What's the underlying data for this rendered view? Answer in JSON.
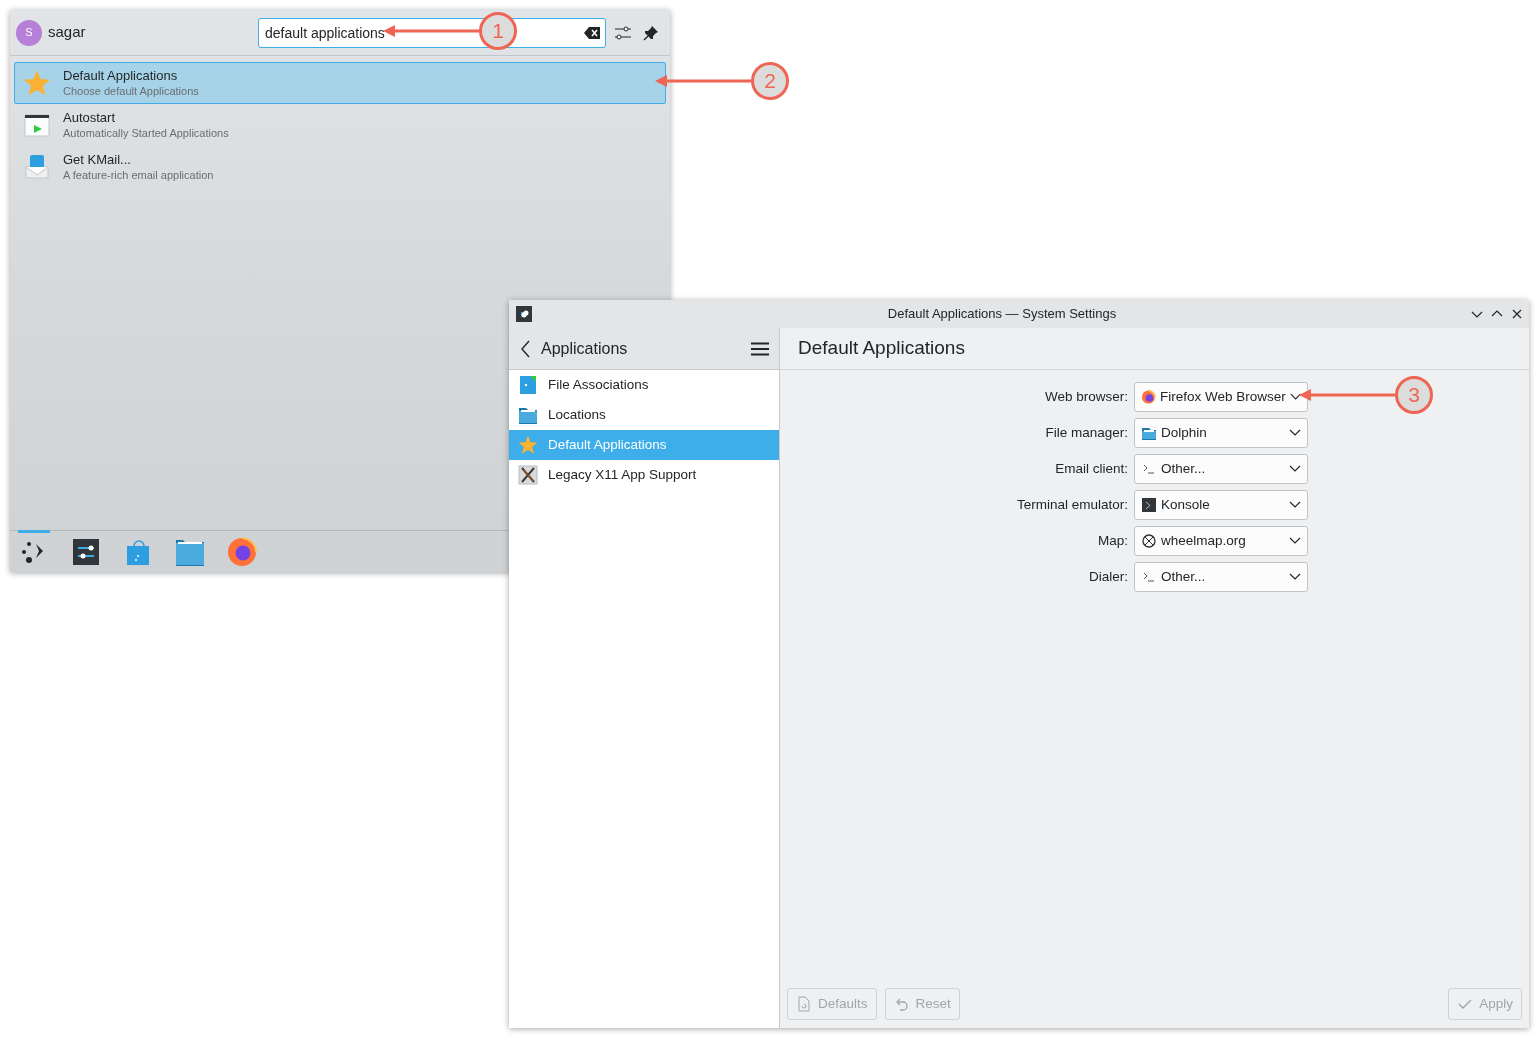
{
  "launcher": {
    "user": {
      "initial": "S",
      "name": "sagar"
    },
    "search": {
      "value": "default applications"
    },
    "results": [
      {
        "title": "Default Applications",
        "subtitle": "Choose default Applications",
        "kind": "star",
        "selected": true
      },
      {
        "title": "Autostart",
        "subtitle": "Automatically Started Applications",
        "kind": "autostart",
        "selected": false
      },
      {
        "title": "Get KMail...",
        "subtitle": "A feature-rich email application",
        "kind": "kmail",
        "selected": false
      }
    ],
    "taskbar": [
      {
        "kind": "launcher",
        "active": true
      },
      {
        "kind": "settings",
        "active": false
      },
      {
        "kind": "store",
        "active": false
      },
      {
        "kind": "folder",
        "active": false
      },
      {
        "kind": "firefox",
        "active": false
      }
    ]
  },
  "settings_window": {
    "title": "Default Applications — System Settings",
    "sidebar": {
      "title": "Applications",
      "items": [
        {
          "label": "File Associations",
          "kind": "fileassoc",
          "selected": false
        },
        {
          "label": "Locations",
          "kind": "folder",
          "selected": false
        },
        {
          "label": "Default Applications",
          "kind": "star",
          "selected": true
        },
        {
          "label": "Legacy X11 App Support",
          "kind": "x11",
          "selected": false
        }
      ]
    },
    "page_title": "Default Applications",
    "fields": [
      {
        "label": "Web browser:",
        "value": "Firefox Web Browser",
        "kind": "firefox"
      },
      {
        "label": "File manager:",
        "value": "Dolphin",
        "kind": "folder"
      },
      {
        "label": "Email client:",
        "value": "Other...",
        "kind": "prompt"
      },
      {
        "label": "Terminal emulator:",
        "value": "Konsole",
        "kind": "terminal"
      },
      {
        "label": "Map:",
        "value": "wheelmap.org",
        "kind": "globe"
      },
      {
        "label": "Dialer:",
        "value": "Other...",
        "kind": "prompt"
      }
    ],
    "buttons": [
      {
        "label": "Defaults",
        "kind": "doc",
        "disabled": true
      },
      {
        "label": "Reset",
        "kind": "undo",
        "disabled": true
      },
      {
        "label": "Apply",
        "kind": "check",
        "disabled": true
      }
    ]
  },
  "annotations": [
    {
      "number": "1"
    },
    {
      "number": "2"
    },
    {
      "number": "3"
    }
  ]
}
